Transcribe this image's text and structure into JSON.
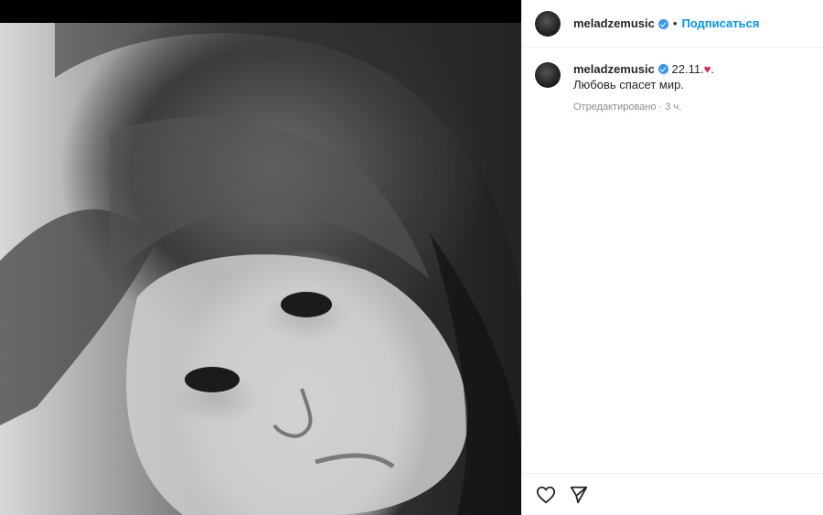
{
  "post": {
    "media": {
      "alt": ""
    }
  },
  "header": {
    "username": "meladzemusic",
    "separator": "•",
    "follow_label": "Подписаться"
  },
  "caption": {
    "username": "meladzemusic",
    "date_text": "22.11.",
    "heart": "♥",
    "trailing": ".",
    "text": "Любовь спасет мир.",
    "meta": "Отредактировано · 3 ч."
  },
  "actions": {
    "like_icon": "heart-outline-icon",
    "share_icon": "send-icon"
  },
  "colors": {
    "accent": "#0095f6",
    "verified": "#3897f0",
    "heart": "#e0245e"
  }
}
